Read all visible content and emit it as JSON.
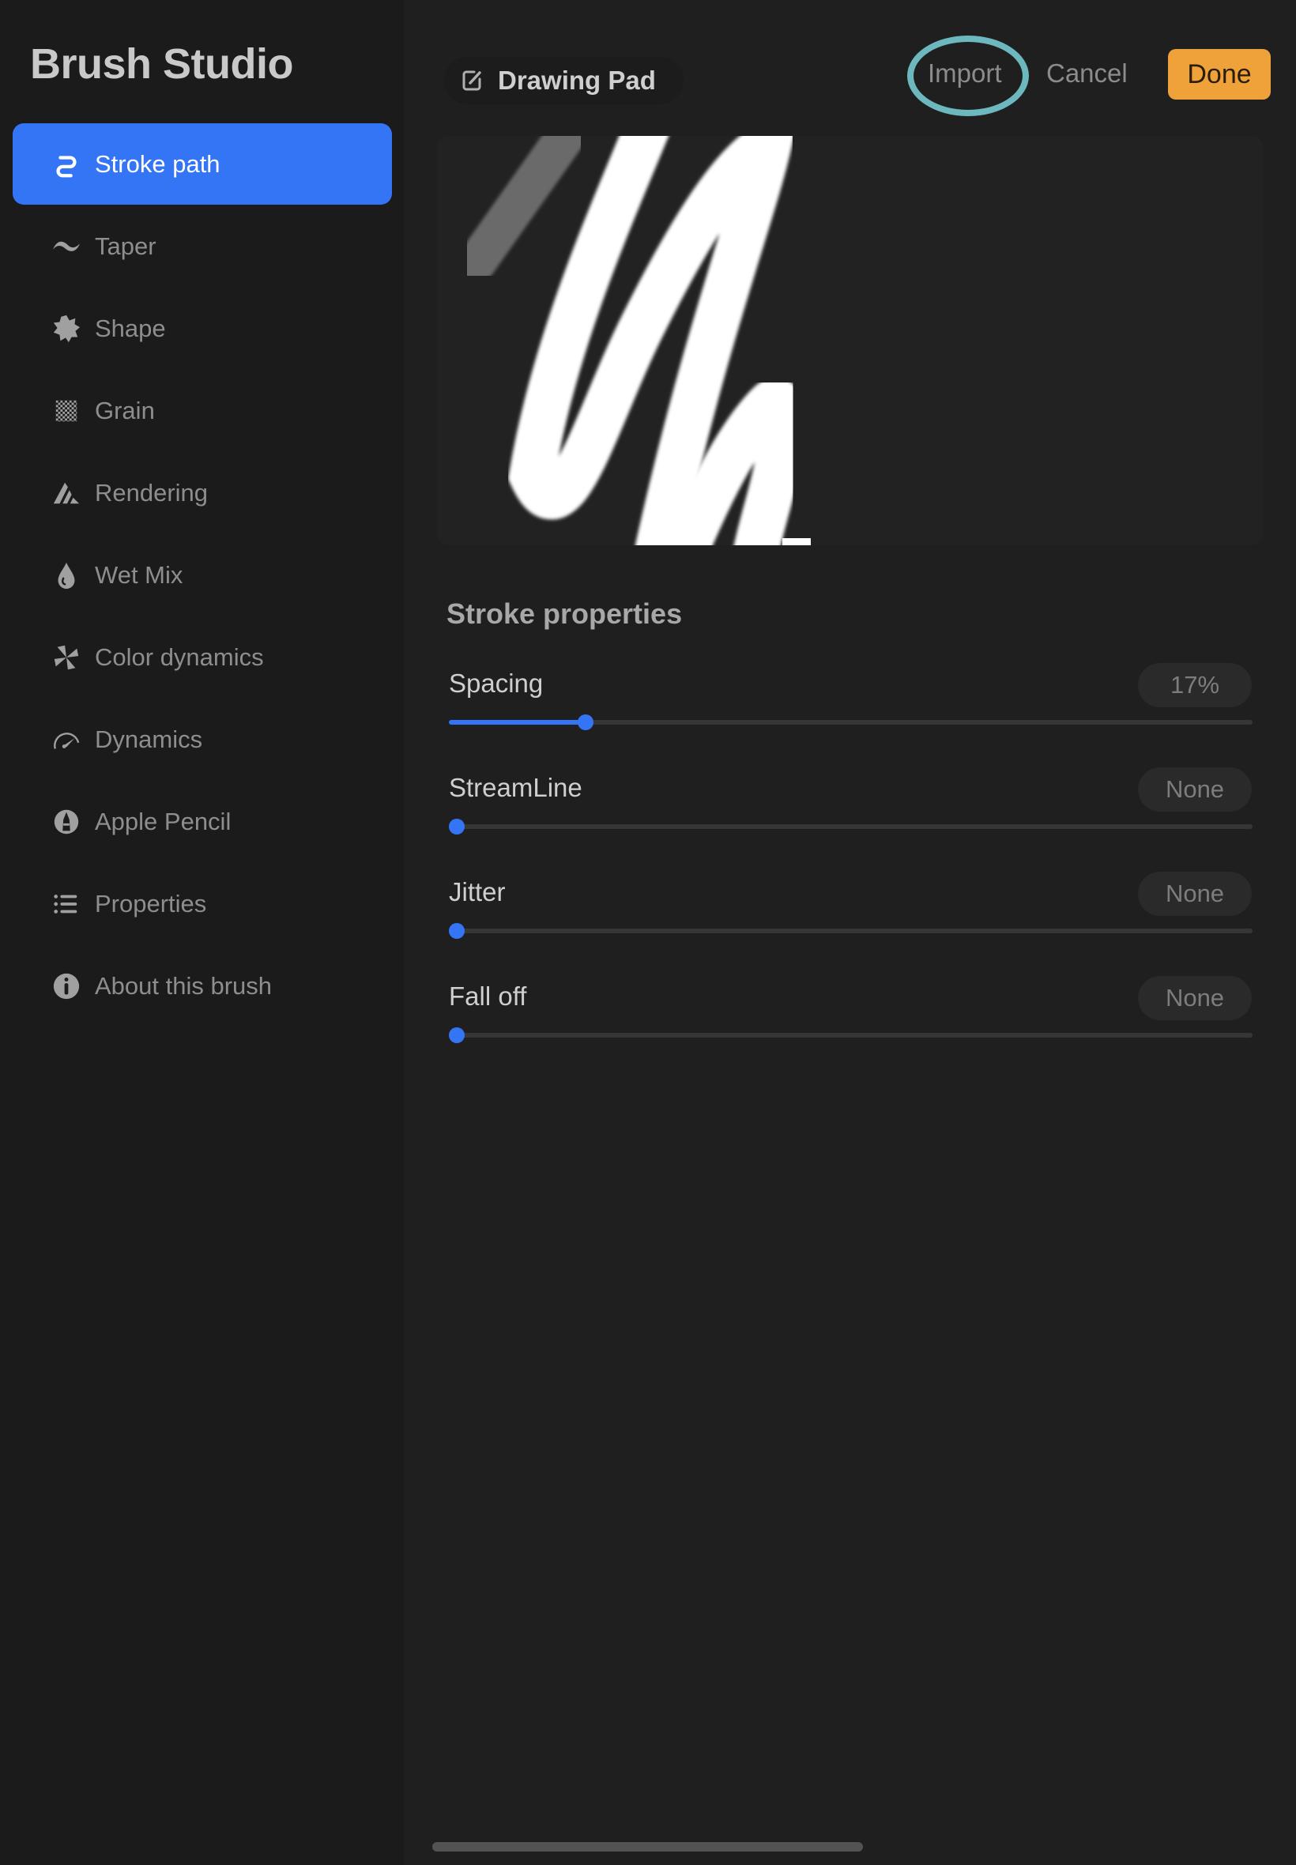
{
  "sidebar": {
    "title": "Brush Studio",
    "items": [
      {
        "label": "Stroke path",
        "icon": "stroke-path-icon",
        "active": true
      },
      {
        "label": "Taper",
        "icon": "taper-icon",
        "active": false
      },
      {
        "label": "Shape",
        "icon": "shape-icon",
        "active": false
      },
      {
        "label": "Grain",
        "icon": "grain-icon",
        "active": false
      },
      {
        "label": "Rendering",
        "icon": "rendering-icon",
        "active": false
      },
      {
        "label": "Wet Mix",
        "icon": "wet-mix-icon",
        "active": false
      },
      {
        "label": "Color dynamics",
        "icon": "color-dynamics-icon",
        "active": false
      },
      {
        "label": "Dynamics",
        "icon": "dynamics-icon",
        "active": false
      },
      {
        "label": "Apple Pencil",
        "icon": "apple-pencil-icon",
        "active": false
      },
      {
        "label": "Properties",
        "icon": "properties-icon",
        "active": false
      },
      {
        "label": "About this brush",
        "icon": "info-icon",
        "active": false
      }
    ]
  },
  "header": {
    "document_name": "Drawing Pad",
    "import_label": "Import",
    "cancel_label": "Cancel",
    "done_label": "Done"
  },
  "colors": {
    "accent": "#3375f5",
    "done": "#f0a23a",
    "highlight_ring": "#6db8bf"
  },
  "stroke_properties": {
    "title": "Stroke properties",
    "sliders": [
      {
        "label": "Spacing",
        "value_text": "17%",
        "fraction": 0.17
      },
      {
        "label": "StreamLine",
        "value_text": "None",
        "fraction": 0.0
      },
      {
        "label": "Jitter",
        "value_text": "None",
        "fraction": 0.0
      },
      {
        "label": "Fall off",
        "value_text": "None",
        "fraction": 0.0
      }
    ]
  }
}
